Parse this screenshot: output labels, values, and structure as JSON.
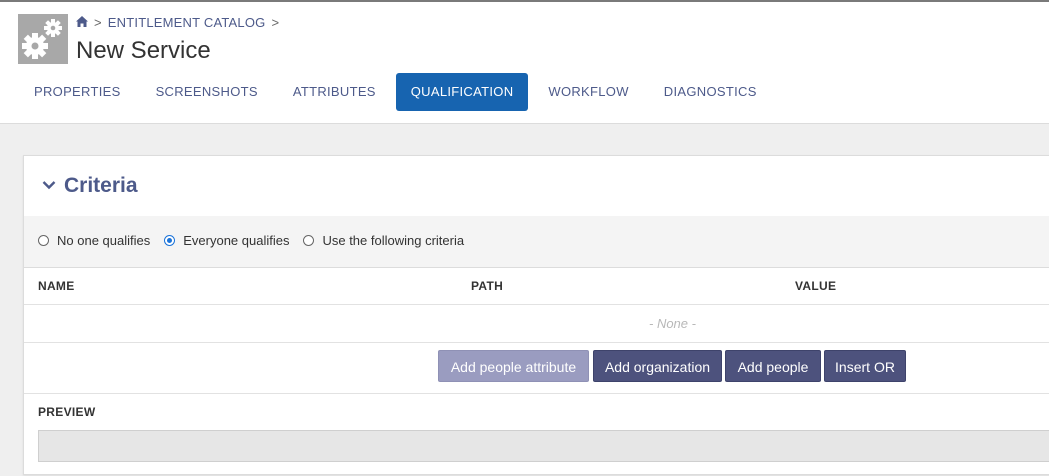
{
  "breadcrumb": {
    "home_icon": "home-icon",
    "separator": ">",
    "items": [
      "ENTITLEMENT CATALOG"
    ]
  },
  "header": {
    "app_icon": "gears-icon",
    "title": "New Service"
  },
  "tabs": [
    {
      "label": "PROPERTIES",
      "active": false
    },
    {
      "label": "SCREENSHOTS",
      "active": false
    },
    {
      "label": "ATTRIBUTES",
      "active": false
    },
    {
      "label": "QUALIFICATION",
      "active": true
    },
    {
      "label": "WORKFLOW",
      "active": false
    },
    {
      "label": "DIAGNOSTICS",
      "active": false
    }
  ],
  "criteria": {
    "title": "Criteria",
    "collapse_icon": "chevron-down-icon",
    "options": [
      {
        "label": "No one qualifies",
        "selected": false
      },
      {
        "label": "Everyone qualifies",
        "selected": true
      },
      {
        "label": "Use the following criteria",
        "selected": false
      }
    ],
    "columns": [
      "NAME",
      "PATH",
      "VALUE"
    ],
    "empty_text": "- None -",
    "buttons": {
      "add_people_attribute": "Add people attribute",
      "add_organization": "Add organization",
      "add_people": "Add people",
      "insert_or": "Insert OR"
    },
    "preview_label": "PREVIEW",
    "preview_value": ""
  },
  "colors": {
    "accent": "#1764b0",
    "title_color": "#4d5a8a",
    "button_primary": "#4d527d",
    "button_disabled": "#9a9cc0"
  }
}
